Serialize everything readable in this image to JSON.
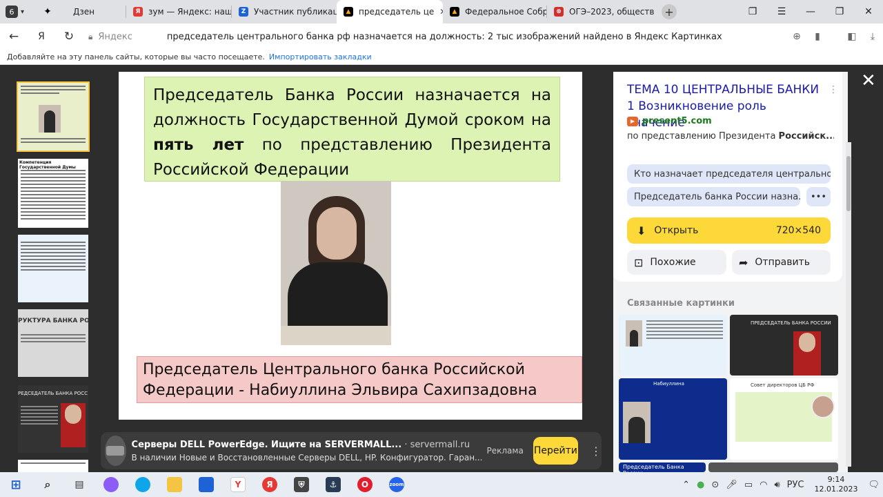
{
  "tabs": {
    "count": "6",
    "items": [
      {
        "label": "Дзен",
        "fav": "✦",
        "color": "#000000"
      },
      {
        "label": "зум — Яндекс: наш",
        "fav": "Я",
        "color": "#e53935"
      },
      {
        "label": "Участник публикац",
        "fav": "Z",
        "color": "#1e63d6"
      },
      {
        "label": "председатель це",
        "fav": "▲",
        "color": "#f5a623",
        "active": true
      },
      {
        "label": "Федеральное Собр",
        "fav": "▲",
        "color": "#f5a623"
      },
      {
        "label": "ОГЭ–2023, обществ",
        "fav": "⊗",
        "color": "#d32f2f"
      }
    ]
  },
  "address": {
    "domain": "Яндекс",
    "title": "председатель центрального банка рф назначается на должность: 2 тыс изображений найдено в Яндекс Картинках"
  },
  "bookmarks": {
    "text": "Добавляйте на эту панель сайты, которые вы часто посещаете.",
    "link": "Импортировать закладки"
  },
  "slide": {
    "head_before": "Председатель Банка России назначается на должность Государственной Думой сроком на ",
    "head_bold": "пять лет",
    "head_after": " по представлению Президента Российской Федерации",
    "foot": "Председатель Центрального банка Российской Федерации  - Набиуллина Эльвира Сахипзадовна"
  },
  "ad": {
    "title": "Серверы DELL PowerEdge. Ищите на SERVERMALL...",
    "domain": "· servermall.ru",
    "desc": "В наличии Новые и Восстановленные Серверы DELL, HP. Конфигуратор. Гаран...",
    "tag": "Реклама",
    "button": "Перейти"
  },
  "panel": {
    "title": "ТЕМА 10 ЦЕНТРАЛЬНЫЕ БАНКИ 1 Возникновение роль значение",
    "source": "present5.com",
    "desc_before": "по представлению Президента ",
    "desc_bold": "Российск...",
    "pill1": "Кто назначает председателя центральног...",
    "pill2": "Председатель банка России назна...",
    "open": "Открыть",
    "size": "720×540",
    "similar": "Похожие",
    "share": "Отправить",
    "related": "Связанные картинки",
    "rel_texts": {
      "r2": "ПРЕДСЕДАТЕЛЬ БАНКА РОССИИ",
      "r3": "Набиуллина",
      "r4": "Совет директоров ЦБ РФ",
      "r5": "Председатель Банка России"
    }
  },
  "thumbs": {
    "t2": "Компетенция Государственной Думы",
    "t4": "РУКТУРА БАНКА РОСС",
    "t5": "РЕДСЕДАТЕЛЬ БАНКА РОСС"
  },
  "tray": {
    "lang": "РУС",
    "time": "9:14",
    "date": "12.01.2023"
  }
}
